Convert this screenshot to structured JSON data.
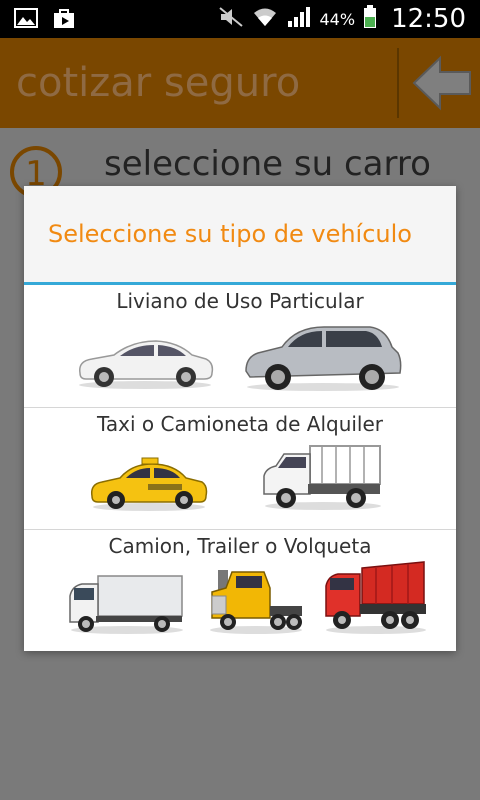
{
  "status_bar": {
    "battery_percent": "44%",
    "time": "12:50"
  },
  "action_bar": {
    "title": "cotizar seguro"
  },
  "step": {
    "number": "1",
    "label": "seleccione su carro"
  },
  "dialog": {
    "title": "Seleccione su tipo de vehículo",
    "sections": [
      {
        "title": "Liviano de Uso Particular",
        "vehicles": [
          "sedan-car",
          "suv"
        ]
      },
      {
        "title": "Taxi o Camioneta de Alquiler",
        "vehicles": [
          "taxi-cab",
          "flatbed-pickup"
        ]
      },
      {
        "title": "Camion, Trailer o Volqueta",
        "vehicles": [
          "box-truck",
          "semi-trailer-truck",
          "dump-truck"
        ]
      }
    ]
  },
  "colors": {
    "accent_orange": "#f18a12",
    "divider_blue": "#35a9d8",
    "dimmed_actionbar": "#7a4700"
  }
}
